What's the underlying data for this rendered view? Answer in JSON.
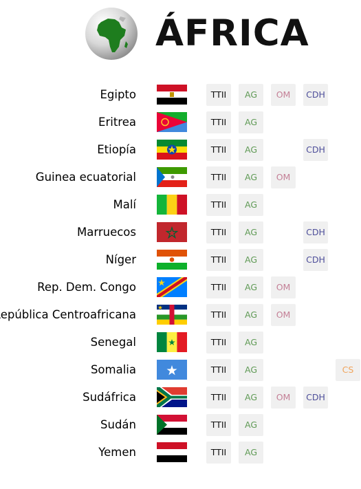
{
  "header": {
    "title": "ÁFRICA",
    "globe_icon": "africa-globe-icon"
  },
  "tag_colors": {
    "TTII": "#111111",
    "AG": "#5f9a55",
    "OM": "#c47f96",
    "CDH": "#4e4f9a",
    "CS": "#f0a45c",
    "tag_background": "#f0f0f0"
  },
  "countries": [
    {
      "name": "Egipto",
      "flag": "egypt-flag-icon",
      "tags": [
        "TTII",
        "AG",
        "OM",
        "CDH"
      ]
    },
    {
      "name": "Eritrea",
      "flag": "eritrea-flag-icon",
      "tags": [
        "TTII",
        "AG"
      ]
    },
    {
      "name": "Etiopía",
      "flag": "ethiopia-flag-icon",
      "tags": [
        "TTII",
        "AG",
        "CDH"
      ]
    },
    {
      "name": "Guinea ecuatorial",
      "flag": "equatorial-guinea-flag-icon",
      "tags": [
        "TTII",
        "AG",
        "OM"
      ]
    },
    {
      "name": "Malí",
      "flag": "mali-flag-icon",
      "tags": [
        "TTII",
        "AG"
      ]
    },
    {
      "name": "Marruecos",
      "flag": "morocco-flag-icon",
      "tags": [
        "TTII",
        "AG",
        "CDH"
      ]
    },
    {
      "name": "Níger",
      "flag": "niger-flag-icon",
      "tags": [
        "TTII",
        "AG",
        "CDH"
      ]
    },
    {
      "name": "Rep. Dem. Congo",
      "flag": "dr-congo-flag-icon",
      "tags": [
        "TTII",
        "AG",
        "OM"
      ]
    },
    {
      "name": "República Centroafricana",
      "flag": "central-african-republic-flag-icon",
      "tags": [
        "TTII",
        "AG",
        "OM"
      ]
    },
    {
      "name": "Senegal",
      "flag": "senegal-flag-icon",
      "tags": [
        "TTII",
        "AG"
      ]
    },
    {
      "name": "Somalia",
      "flag": "somalia-flag-icon",
      "tags": [
        "TTII",
        "AG",
        "CS"
      ]
    },
    {
      "name": "Sudáfrica",
      "flag": "south-africa-flag-icon",
      "tags": [
        "TTII",
        "AG",
        "OM",
        "CDH"
      ]
    },
    {
      "name": "Sudán",
      "flag": "sudan-flag-icon",
      "tags": [
        "TTII",
        "AG"
      ]
    },
    {
      "name": "Yemen",
      "flag": "yemen-flag-icon",
      "tags": [
        "TTII",
        "AG"
      ]
    }
  ]
}
